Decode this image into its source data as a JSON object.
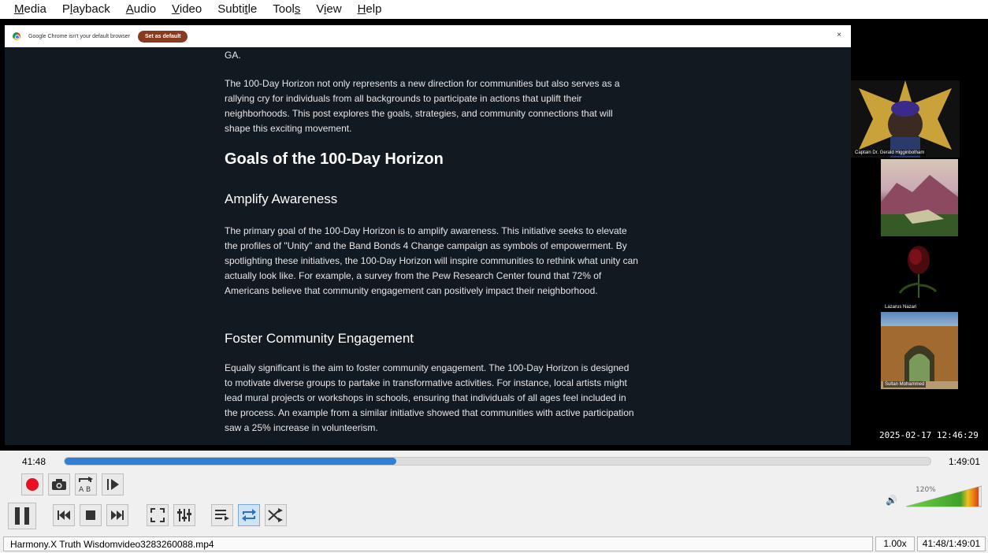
{
  "menu": [
    {
      "pre": "",
      "ul": "M",
      "post": "edia"
    },
    {
      "pre": "P",
      "ul": "l",
      "post": "ayback"
    },
    {
      "pre": "",
      "ul": "A",
      "post": "udio"
    },
    {
      "pre": "",
      "ul": "V",
      "post": "ideo"
    },
    {
      "pre": "Subti",
      "ul": "t",
      "post": "le"
    },
    {
      "pre": "Tool",
      "ul": "s",
      "post": ""
    },
    {
      "pre": "V",
      "ul": "i",
      "post": "ew"
    },
    {
      "pre": "",
      "ul": "H",
      "post": "elp"
    }
  ],
  "infobar": {
    "message": "Google Chrome isn't your default browser",
    "button": "Set as default",
    "close": "×"
  },
  "article": {
    "ga": "GA.",
    "intro": "The 100-Day Horizon not only represents a new direction for communities but also serves as a rallying cry for individuals from all backgrounds to participate in actions that uplift their neighborhoods. This post explores the goals, strategies, and community connections that will shape this exciting movement.",
    "goals_heading": "Goals of the 100-Day Horizon",
    "amplify_heading": "Amplify Awareness",
    "amplify_body": "The primary goal of the 100-Day Horizon is to amplify awareness. This initiative seeks to elevate the profiles of \"Unity\" and the Band Bonds 4 Change campaign as symbols of empowerment. By spotlighting these initiatives, the 100-Day Horizon will inspire communities to rethink what unity can actually look like. For example, a survey from the Pew Research Center found that 72% of Americans believe that community engagement can positively impact their neighborhood.",
    "foster_heading": "Foster Community Engagement",
    "foster_body": "Equally significant is the aim to foster community engagement. The 100-Day Horizon is designed to motivate diverse groups to partake in transformative activities. For instance, local artists might lead mural projects or workshops in schools, ensuring that individuals of all ages feel included in the process. An example from a similar initiative showed that communities with active participation saw a 25% increase in volunteerism."
  },
  "participants": {
    "host": "Captain Dr. Gerald Higginbotham",
    "rose": "Lazarus Nazari",
    "fort": "Sultan Mohammed"
  },
  "timestamp": "2025-02-17 12:46:29",
  "player": {
    "elapsed": "41:48",
    "total": "1:49:01",
    "progress": 0.383,
    "volume_percent": "120%",
    "volume_level": 1.2
  },
  "status": {
    "filename": "Harmony.X Truth Wisdomvideo3283260088.mp4",
    "speed": "1.00x",
    "time": "41:48/1:49:01"
  },
  "colors": {
    "accent": "#2f7fd6",
    "record": "#e81123",
    "set_default_button": "#8a3b1e"
  }
}
